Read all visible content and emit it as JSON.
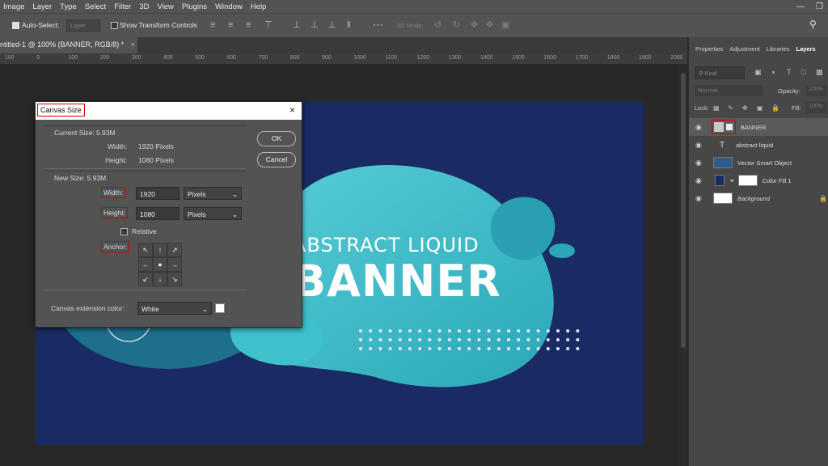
{
  "menu": [
    "Image",
    "Layer",
    "Type",
    "Select",
    "Filter",
    "3D",
    "View",
    "Plugins",
    "Window",
    "Help"
  ],
  "options": {
    "auto_select_label": "Auto-Select:",
    "auto_select_value": "Layer",
    "transform_label": "Show Transform Controls",
    "mode_3d": "3D Mode:"
  },
  "document_tab": {
    "title": "ntitled-1 @ 100% (BANNER, RGB/8) *",
    "close": "×"
  },
  "ruler_ticks": [
    "100",
    "0",
    "100",
    "200",
    "300",
    "400",
    "500",
    "600",
    "700",
    "800",
    "900",
    "1000",
    "1100",
    "1200",
    "1300",
    "1400",
    "1500",
    "1600",
    "1700",
    "1800",
    "1900",
    "2000"
  ],
  "banner": {
    "subtitle": "ABSTRACT LIQUID",
    "title": "BANNER"
  },
  "panel": {
    "tabs": [
      "Properties",
      "Adjustment",
      "Libraries",
      "Layers"
    ],
    "active_tab": "Layers",
    "kind_placeholder": "Kind",
    "blend_mode": "Normal",
    "opacity_label": "Opacity:",
    "opacity_value": "100%",
    "lock_label": "Lock:",
    "fill_label": "Fill:",
    "fill_value": "100%",
    "layers": [
      {
        "name": "BANNER"
      },
      {
        "name": "abstract liquid"
      },
      {
        "name": "Vector Smart Object"
      },
      {
        "name": "Color Fill 1"
      },
      {
        "name": "Background"
      }
    ]
  },
  "dialog": {
    "title": "Canvas Size",
    "close": "×",
    "current_size_label": "Current Size: 5.93M",
    "current_width_label": "Width:",
    "current_width_value": "1920 Pixels",
    "current_height_label": "Height:",
    "current_height_value": "1080 Pixels",
    "new_size_label": "New Size: 5.93M",
    "width_label": "Width:",
    "width_value": "1920",
    "width_unit": "Pixels",
    "height_label": "Height:",
    "height_value": "1080",
    "height_unit": "Pixels",
    "relative_label": "Relative",
    "anchor_label": "Anchor:",
    "extension_color_label": "Canvas extension color:",
    "extension_color_value": "White",
    "ok": "OK",
    "cancel": "Cancel"
  },
  "colors": {
    "canvas_bg": "#1a2a63",
    "liquid_primary": "#3ec1cb",
    "liquid_dark": "#1e6f8c",
    "highlight_red": "#d10000",
    "ui_gray": "#535353"
  }
}
